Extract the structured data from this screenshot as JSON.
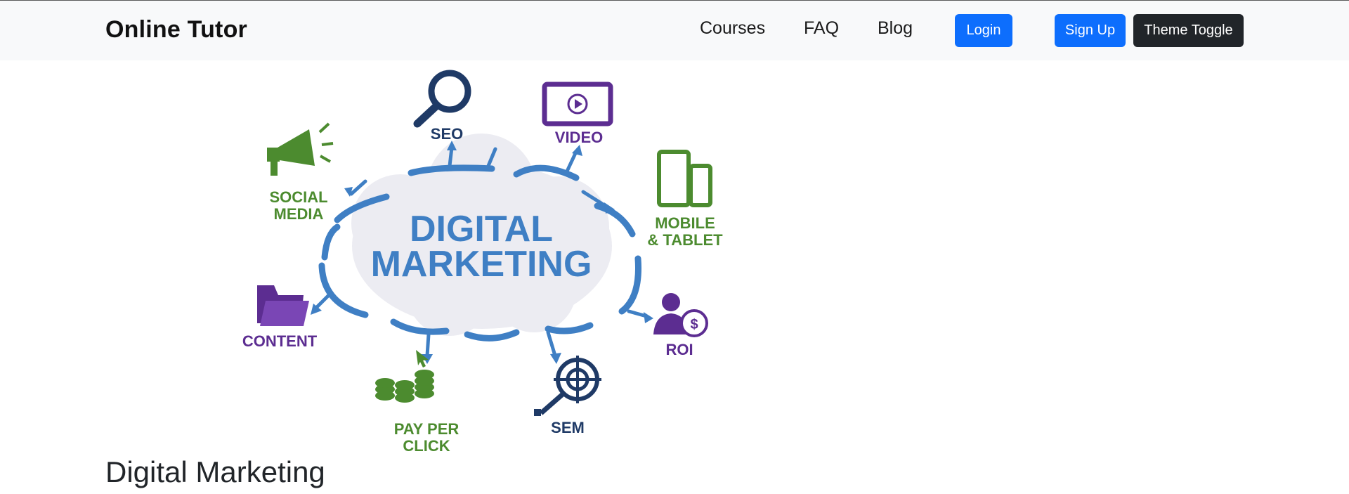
{
  "navbar": {
    "brand": "Online Tutor",
    "links": [
      {
        "label": "Courses"
      },
      {
        "label": "FAQ"
      },
      {
        "label": "Blog"
      }
    ],
    "login_label": "Login",
    "signup_label": "Sign Up",
    "theme_toggle_label": "Theme Toggle"
  },
  "hero": {
    "center_line1": "DIGITAL",
    "center_line2": "MARKETING",
    "items": {
      "seo": "SEO",
      "video": "VIDEO",
      "social_line1": "SOCIAL",
      "social_line2": "MEDIA",
      "mobile_line1": "MOBILE",
      "mobile_line2": "& TABLET",
      "content": "CONTENT",
      "roi": "ROI",
      "ppc_line1": "PAY PER",
      "ppc_line2": "CLICK",
      "sem": "SEM"
    },
    "colors": {
      "blue": "#3f7fc4",
      "navy": "#1f3a66",
      "purple": "#5c2d91",
      "green": "#4c8b2f",
      "cloud": "#ececf2"
    }
  },
  "main": {
    "section_title": "Digital Marketing"
  }
}
